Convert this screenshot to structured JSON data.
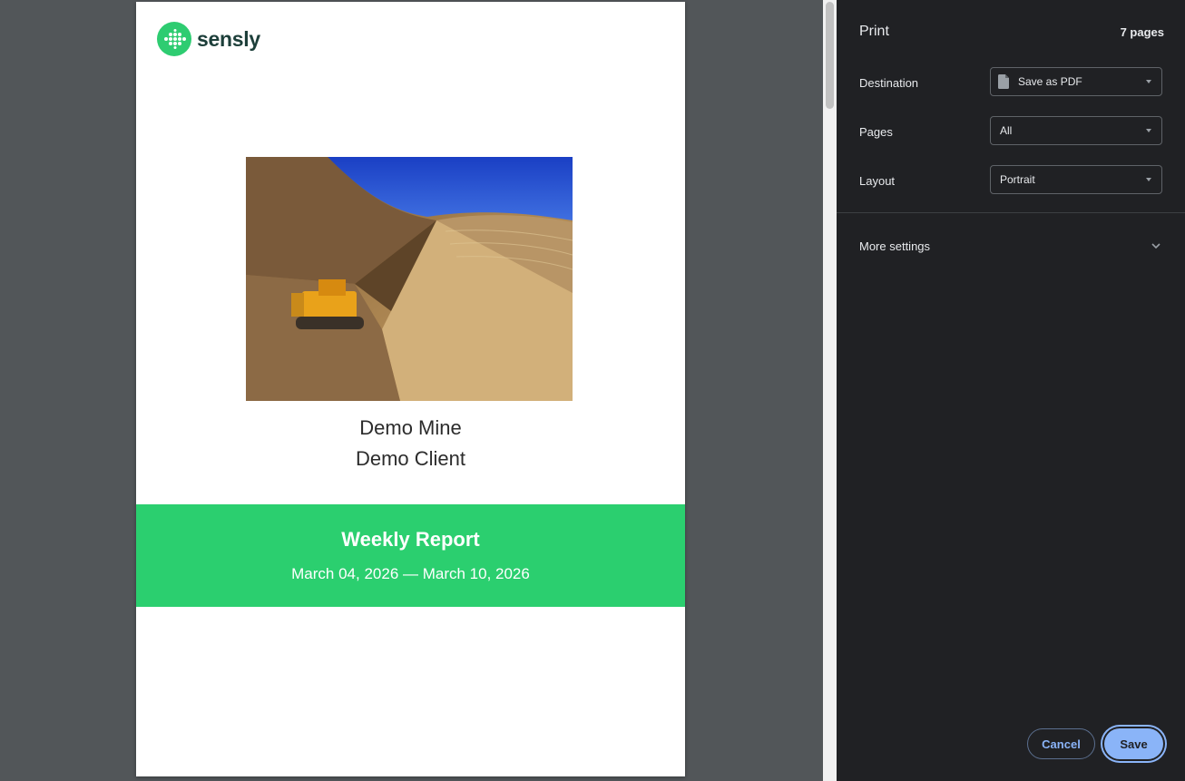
{
  "preview": {
    "brand": "sensly",
    "mine": "Demo Mine",
    "client": "Demo Client",
    "report_title": "Weekly Report",
    "date_range": "March 04, 2026 — March 10, 2026",
    "banner_color": "#2bcf6f"
  },
  "panel": {
    "title": "Print",
    "sheet_count": "7 pages",
    "destination_label": "Destination",
    "destination_value": "Save as PDF",
    "pages_label": "Pages",
    "pages_value": "All",
    "layout_label": "Layout",
    "layout_value": "Portrait",
    "more_settings": "More settings",
    "cancel": "Cancel",
    "save": "Save"
  }
}
